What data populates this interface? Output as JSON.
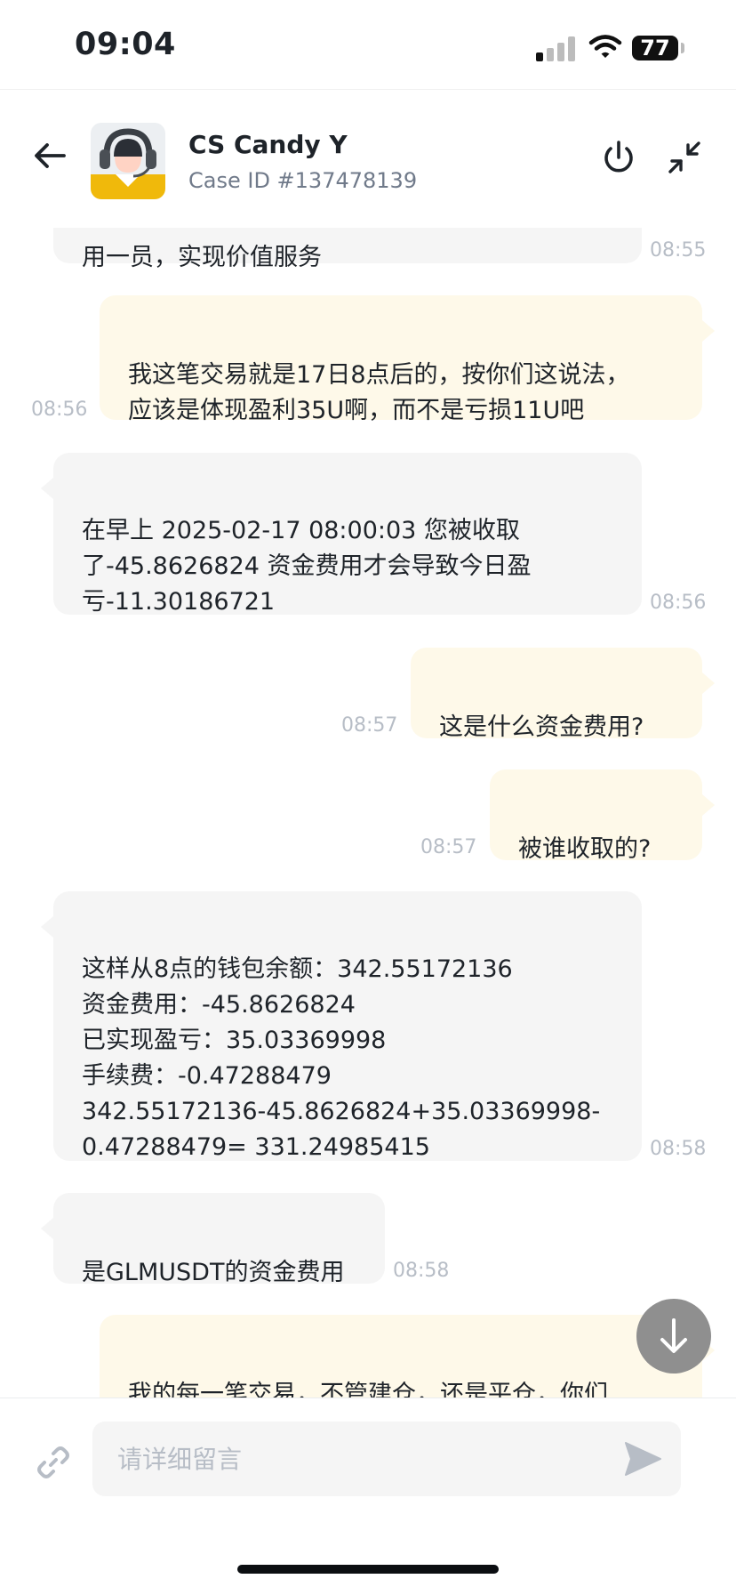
{
  "status_bar": {
    "time": "09:04",
    "battery": "77"
  },
  "header": {
    "agent_name": "CS Candy Y",
    "case_id": "Case ID #137478139"
  },
  "messages": [
    {
      "text": "用一员，实现价值服务",
      "time": "08:55"
    },
    {
      "text": "我这笔交易就是17日8点后的，按你们这说法，\n应该是体现盈利35U啊，而不是亏损11U吧",
      "time": "08:56"
    },
    {
      "text": "在早上 2025-02-17 08:00:03 您被收取\n了-45.8626824 资金费用才会导致今日盈\n亏-11.30186721",
      "time": "08:56"
    },
    {
      "text": "这是什么资金费用?",
      "time": "08:57"
    },
    {
      "text": "被谁收取的?",
      "time": "08:57"
    },
    {
      "text": "这样从8点的钱包余额：342.55172136\n资金费用：-45.8626824\n已实现盈亏：35.03369998\n手续费：-0.47288479\n342.55172136-45.8626824+35.03369998-\n0.47288479= 331.24985415",
      "time": "08:58"
    },
    {
      "text": "是GLMUSDT的资金费用",
      "time": "08:58"
    },
    {
      "text": "我的每一笔交易，不管建仓，还是平仓，你们\n都收取了手续费用"
    }
  ],
  "composer": {
    "placeholder": "请详细留言"
  },
  "icons": {
    "back": "arrow-left-icon",
    "power": "power-icon",
    "minimize": "minimize-icon",
    "scroll_down": "arrow-down-icon",
    "attach": "link-icon",
    "send": "send-icon"
  },
  "colors": {
    "incoming_bubble": "#f5f5f5",
    "outgoing_bubble": "#fef9e9",
    "brand_yellow": "#f0b90b",
    "timestamp": "#b7bdc6"
  }
}
